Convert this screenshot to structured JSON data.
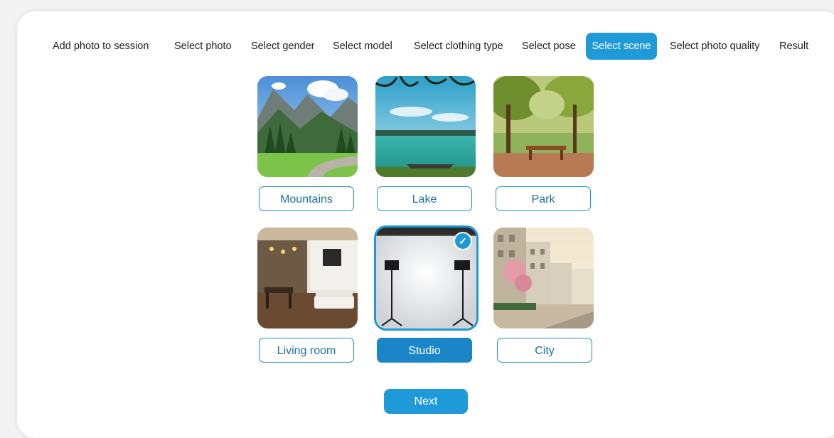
{
  "steps": [
    {
      "label": "Add photo to session",
      "active": false
    },
    {
      "label": "Select photo",
      "active": false
    },
    {
      "label": "Select gender",
      "active": false
    },
    {
      "label": "Select model",
      "active": false
    },
    {
      "label": "Select clothing type",
      "active": false
    },
    {
      "label": "Select pose",
      "active": false
    },
    {
      "label": "Select scene",
      "active": true
    },
    {
      "label": "Select photo quality",
      "active": false
    },
    {
      "label": "Result",
      "active": false
    }
  ],
  "scenes": [
    {
      "name": "Mountains",
      "image": "mountains-image",
      "selected": false
    },
    {
      "name": "Lake",
      "image": "lake-image",
      "selected": false
    },
    {
      "name": "Park",
      "image": "park-image",
      "selected": false
    },
    {
      "name": "Living room",
      "image": "living-room-image",
      "selected": false
    },
    {
      "name": "Studio",
      "image": "studio-image",
      "selected": true
    },
    {
      "name": "City",
      "image": "city-image",
      "selected": false
    }
  ],
  "selected_check_icon": "checkmark-icon",
  "next_label": "Next",
  "colors": {
    "accent": "#1f9ad9",
    "accent_dark": "#1a86c8",
    "label_text": "#1f6f9f"
  }
}
